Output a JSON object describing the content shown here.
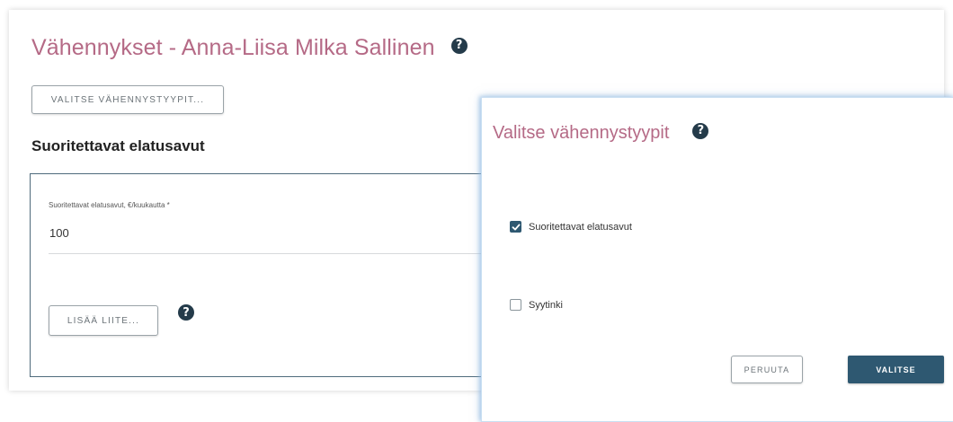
{
  "page": {
    "title": "Vähennykset - Anna-Liisa Milka Sallinen",
    "help_glyph": "?",
    "select_types_button": "VALITSE VÄHENNYSTYYPIT..."
  },
  "section": {
    "title": "Suoritettavat elatusavut",
    "field_label": "Suoritettavat elatusavut, €/kuukautta *",
    "field_value": "100",
    "add_attachment_button": "LISÄÄ LIITE..."
  },
  "modal": {
    "title": "Valitse vähennystyypit",
    "options": [
      {
        "label": "Suoritettavat elatusavut",
        "checked": true
      },
      {
        "label": "Syytinki",
        "checked": false
      }
    ],
    "cancel_button": "PERUUTA",
    "confirm_button": "VALITSE"
  },
  "icons": {
    "help": "help-icon",
    "check": "check-icon"
  },
  "colors": {
    "title_pink": "#b56a86",
    "primary_blue": "#2e5871",
    "help_icon_bg": "#243b4a"
  }
}
